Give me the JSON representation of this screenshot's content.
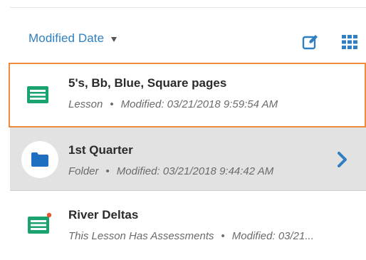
{
  "toolbar": {
    "sort_label": "Modified Date",
    "sort_caret_icon": "caret-down-icon",
    "edit_icon": "edit-icon",
    "grid_icon": "grid-view-icon"
  },
  "items": [
    {
      "title": "5's, Bb, Blue, Square pages",
      "type": "Lesson",
      "separator": "•",
      "modified": "Modified: 03/21/2018 9:59:54 AM",
      "icon": "lesson-icon",
      "selected": true
    },
    {
      "title": "1st Quarter",
      "type": "Folder",
      "separator": "•",
      "modified": "Modified: 03/21/2018 9:44:42 AM",
      "icon": "folder-icon",
      "action_icon": "chevron-right-icon"
    },
    {
      "title": "River Deltas",
      "type": "This Lesson Has Assessments",
      "separator": "•",
      "modified": "Modified: 03/21...",
      "icon": "lesson-icon",
      "badge_icon": "dot-badge-icon"
    }
  ],
  "colors": {
    "accent_blue": "#2f7fc1",
    "lesson_green": "#1aa36f",
    "selection_orange": "#f08a3c",
    "folder_row_bg": "#e2e2e2",
    "badge_orange": "#e8552b"
  }
}
